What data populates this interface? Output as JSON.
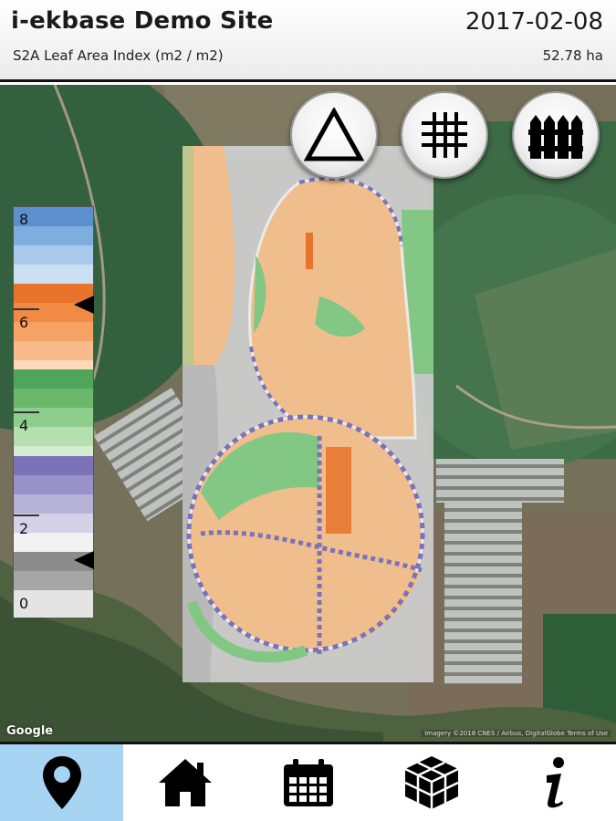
{
  "header": {
    "site_title": "i-ekbase Demo Site",
    "date": "2017-02-08",
    "layer_name": "S2A Leaf Area Index (m2 / m2)",
    "area": "52.78 ha"
  },
  "map_buttons": [
    {
      "icon": "triangle-icon"
    },
    {
      "icon": "grid-icon"
    },
    {
      "icon": "fence-icon"
    }
  ],
  "legend": {
    "labels": [
      "8",
      "6",
      "4",
      "2",
      "0"
    ],
    "markers": [
      6.5,
      1.7
    ],
    "colors": {
      "blue": "#5b8fcd",
      "orange": "#e8732a",
      "green": "#6bb86b",
      "purple": "#7b72b8",
      "gray": "#8c8c8c"
    }
  },
  "map": {
    "google_logo": "Google",
    "attribution": "Imagery ©2018 CNES / Airbus, DigitalGlobe    Terms of Use"
  },
  "bottom_nav": {
    "active": "map",
    "items": [
      {
        "id": "map",
        "icon": "map-pin-icon"
      },
      {
        "id": "home",
        "icon": "home-icon"
      },
      {
        "id": "calendar",
        "icon": "calendar-icon"
      },
      {
        "id": "blocks",
        "icon": "blocks-icon"
      },
      {
        "id": "info",
        "icon": "info-icon"
      }
    ]
  }
}
